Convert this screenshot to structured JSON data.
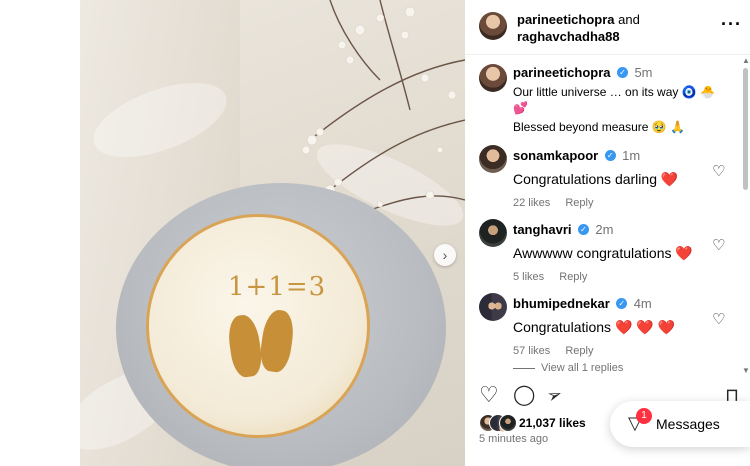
{
  "post": {
    "image_text": "1+1=3",
    "next_icon": "chevron-right-icon"
  },
  "header": {
    "author": "parineetichopra",
    "and_text": "and",
    "coauthor": "raghavchadha88",
    "more_icon": "more-horizontal-icon"
  },
  "caption": {
    "username": "parineetichopra",
    "time": "5m",
    "line1": "Our little universe … on its way 🧿 🐣",
    "line1_emoji_2": "💕",
    "line2": "Blessed beyond measure 🥹 🙏"
  },
  "comments": [
    {
      "username": "sonamkapoor",
      "time": "1m",
      "text": "Congratulations darling",
      "emoji": "❤️",
      "likes": "22 likes",
      "reply": "Reply"
    },
    {
      "username": "tanghavri",
      "time": "2m",
      "text": "Awwwww congratulations",
      "emoji": "❤️",
      "likes": "5 likes",
      "reply": "Reply"
    },
    {
      "username": "bhumipednekar",
      "time": "4m",
      "text": "Congratulations",
      "emoji": "❤️ ❤️ ❤️",
      "likes": "57 likes",
      "reply": "Reply"
    }
  ],
  "view_replies": "View all 1 replies",
  "likes_count": "21,037 likes",
  "posted": "5 minutes ago",
  "messages": {
    "label": "Messages",
    "badge": "1"
  },
  "colors": {
    "verified": "#3897f0",
    "heart": "#ed4956",
    "badge": "#ff3040"
  }
}
